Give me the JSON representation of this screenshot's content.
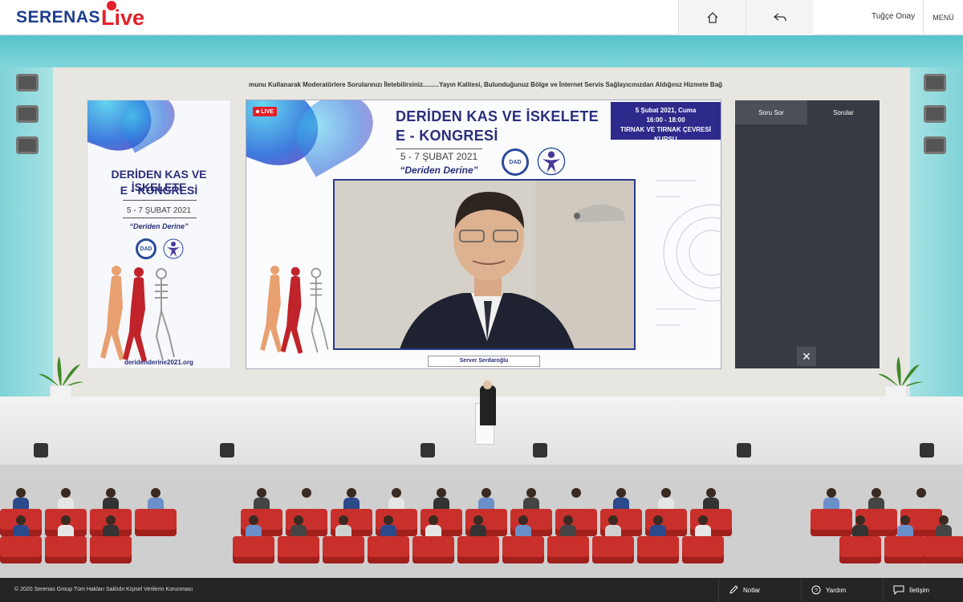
{
  "header": {
    "logo_main": "SERENAS",
    "logo_accent": "Live",
    "user_name": "Tuğçe Onay",
    "menu_label": "MENÜ"
  },
  "ticker": {
    "text": "munu Kullanarak Moderatörlere Sorularınızı İletebilirsiniz.........Yayın Kalitesi, Bulunduğunuz Bölge ve İnternet Servis Sağlayıcınızdan Aldığınız Hizmete Bağlı Olarak Değ"
  },
  "poster": {
    "title_line1": "DERİDEN KAS VE İSKELETE",
    "title_line2": "E - KONGRESİ",
    "dates": "5 - 7 ŞUBAT 2021",
    "tagline": "“Deriden Derine”",
    "badge_text": "DAD",
    "url": "deridenderine2021.org"
  },
  "screen": {
    "live_label": "LIVE",
    "title_line1": "DERİDEN KAS VE İSKELETE",
    "title_line2": "E - KONGRESİ",
    "dates": "5 - 7 ŞUBAT 2021",
    "tagline": "“Deriden Derine”",
    "session_date": "5 Şubat 2021, Cuma",
    "session_time": "16:00 - 18:00",
    "session_name": "TIRNAK VE TIRNAK ÇEVRESİ KURSU",
    "speaker_name": "Server Serdaroğlu"
  },
  "qa": {
    "tab_ask": "Soru Sor",
    "tab_questions": "Sorular",
    "close_symbol": "✕"
  },
  "footer": {
    "copyright": "© 2020 Serenas Group Tüm Hakları Saklıdır",
    "privacy": "Kişisel Verilerin Korunması",
    "notes": "Notlar",
    "help": "Yardım",
    "contact": "İletişim"
  },
  "colors": {
    "brand_blue": "#1e3d8f",
    "brand_red": "#e3202a",
    "hall_teal": "#6fd1d6",
    "seat_red": "#c9302c",
    "qa_panel": "#363a42"
  }
}
